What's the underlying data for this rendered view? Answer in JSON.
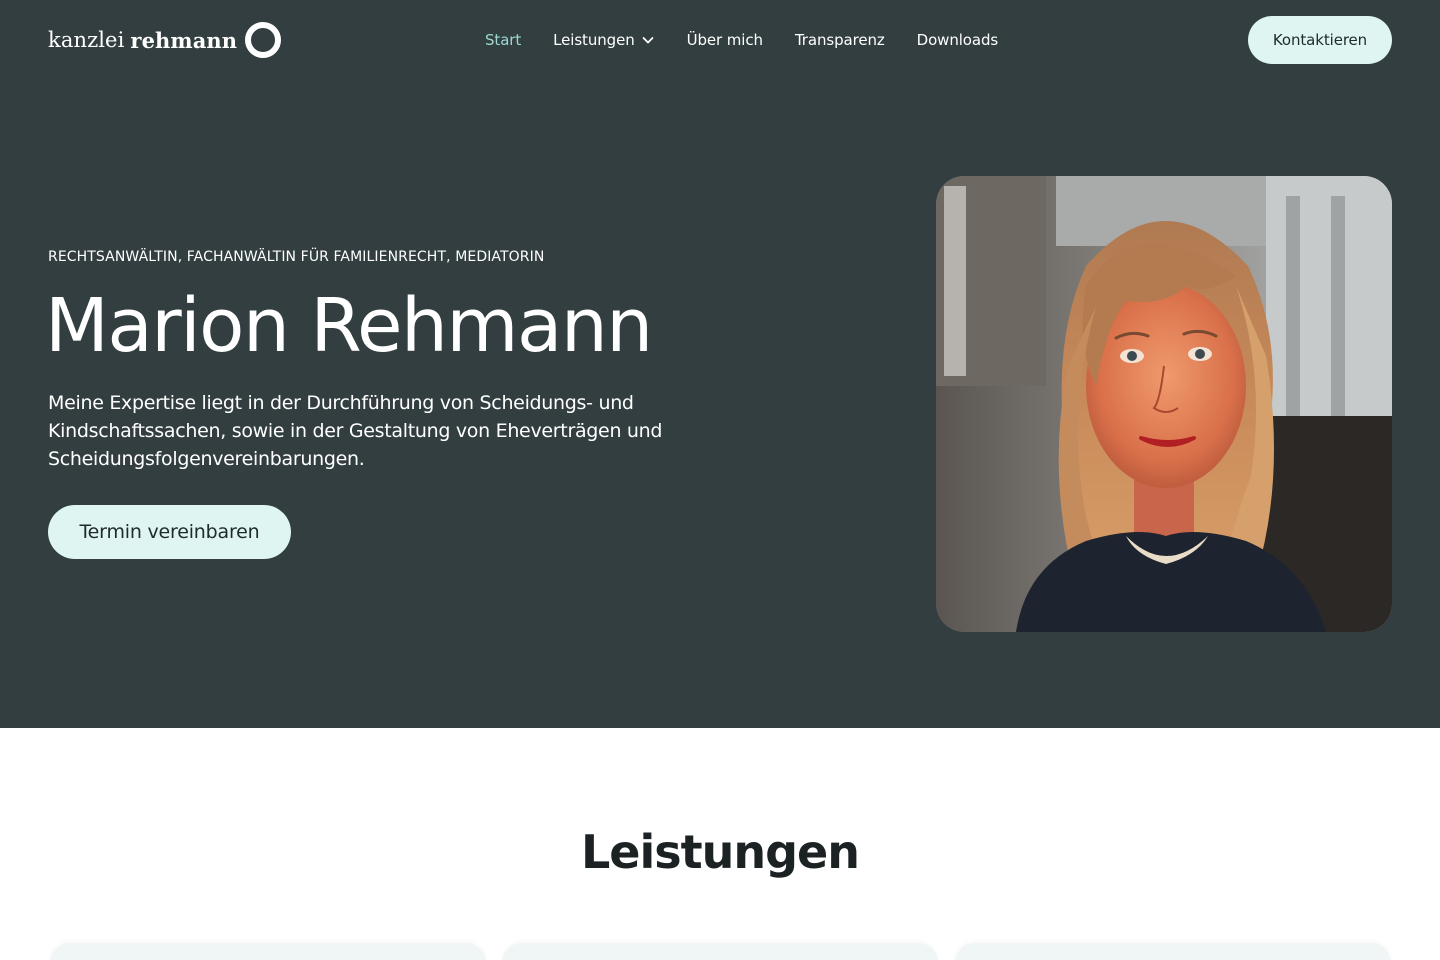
{
  "header": {
    "logo_word1": "kanzlei",
    "logo_word2": "rehmann",
    "nav": [
      {
        "label": "Start",
        "active": true
      },
      {
        "label": "Leistungen",
        "has_dropdown": true
      },
      {
        "label": "Über mich"
      },
      {
        "label": "Transparenz"
      },
      {
        "label": "Downloads"
      }
    ],
    "cta_label": "Kontaktieren"
  },
  "hero": {
    "eyebrow": "RECHTSANWÄLTIN, FACHANWÄLTIN FÜR FAMILIENRECHT, MEDIATORIN",
    "title": "Marion Rehmann",
    "text": "Meine Expertise liegt in der Durchführung von Scheidungs- und Kindschaftssachen, sowie in der Gestaltung von Eheverträgen und Scheidungsfolgenvereinbarungen.",
    "cta_label": "Termin vereinbaren",
    "portrait_icon": "portrait-photo"
  },
  "services": {
    "title": "Leistungen",
    "card_count_visible": 3
  },
  "colors": {
    "hero_bg": "#323e40",
    "accent_active_nav": "#9ed8d2",
    "button_bg": "#dff5f1",
    "card_bg": "#f0f6f5"
  }
}
